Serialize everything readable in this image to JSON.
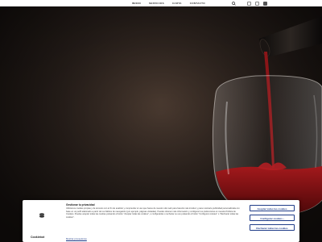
{
  "nav": {
    "items": [
      {
        "label": "INICIO"
      },
      {
        "label": "SERVICIOS"
      },
      {
        "label": "CARTA"
      },
      {
        "label": "CONTACTO"
      }
    ]
  },
  "cookie": {
    "title": "Gestionar tu privacidad",
    "text": "Utilizamos cookies propias y de terceros con el fin de analizar y comprender el uso que haces de nuestro sitio web para hacerlo más intuitivo y para mostrarte publicidad personalizada con base en un perfil elaborado a partir de tus hábitos de navegación (por ejemplo, páginas visitadas). Puedes obtener más información y configurar tus preferencias en nuestra Política de Cookies. Puedes aceptar todas las cookies pulsando el botón \"Aceptar todas las cookies\", o configurarlas o rechazar su uso pulsando el botón \"Configurar cookies\" o \"Rechazar todas las cookies\".",
    "link": "Mostrar proveedores",
    "accept_label": "Aceptar todas las cookies",
    "config_label": "Configurar cookies ›",
    "reject_label": "Rechazar todas las cookies",
    "brand": "Cookiebot"
  },
  "icons": {
    "search": "search-icon",
    "facebook": "facebook-icon",
    "mail": "mail-icon",
    "instagram": "instagram-icon"
  },
  "colors": {
    "accent": "#1f3c88",
    "wine": "#7a1414"
  }
}
